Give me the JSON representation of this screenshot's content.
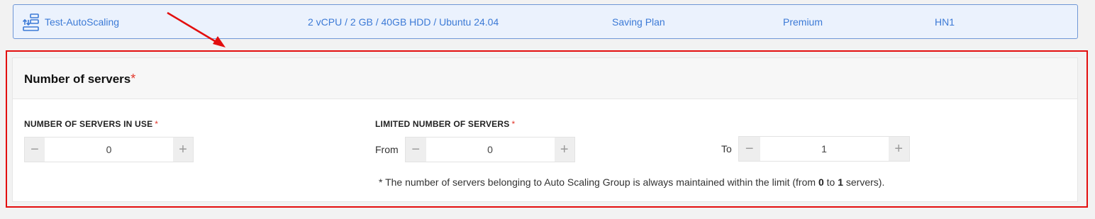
{
  "summary": {
    "name": "Test-AutoScaling",
    "spec": "2 vCPU / 2 GB / 40GB HDD / Ubuntu 24.04",
    "plan": "Saving Plan",
    "tier": "Premium",
    "region": "HN1",
    "icon": "autoscaling-group-icon"
  },
  "section": {
    "title": "Number of servers",
    "required_mark": "*"
  },
  "in_use": {
    "label": "NUMBER OF SERVERS IN USE",
    "required_mark": "*",
    "value": "0",
    "minus": "−",
    "plus": "+"
  },
  "limit": {
    "label": "LIMITED NUMBER OF SERVERS",
    "required_mark": "*",
    "from_label": "From",
    "from_value": "0",
    "to_label": "To",
    "to_value": "1",
    "minus": "−",
    "plus": "+"
  },
  "note": {
    "prefix": "* The number of servers belonging to Auto Scaling Group is always maintained within the limit (from ",
    "from": "0",
    "middle": " to ",
    "to": "1",
    "suffix": " servers)."
  },
  "colors": {
    "accent": "#3c7ad6",
    "highlight": "#e30e0e",
    "required": "#e2372b"
  }
}
